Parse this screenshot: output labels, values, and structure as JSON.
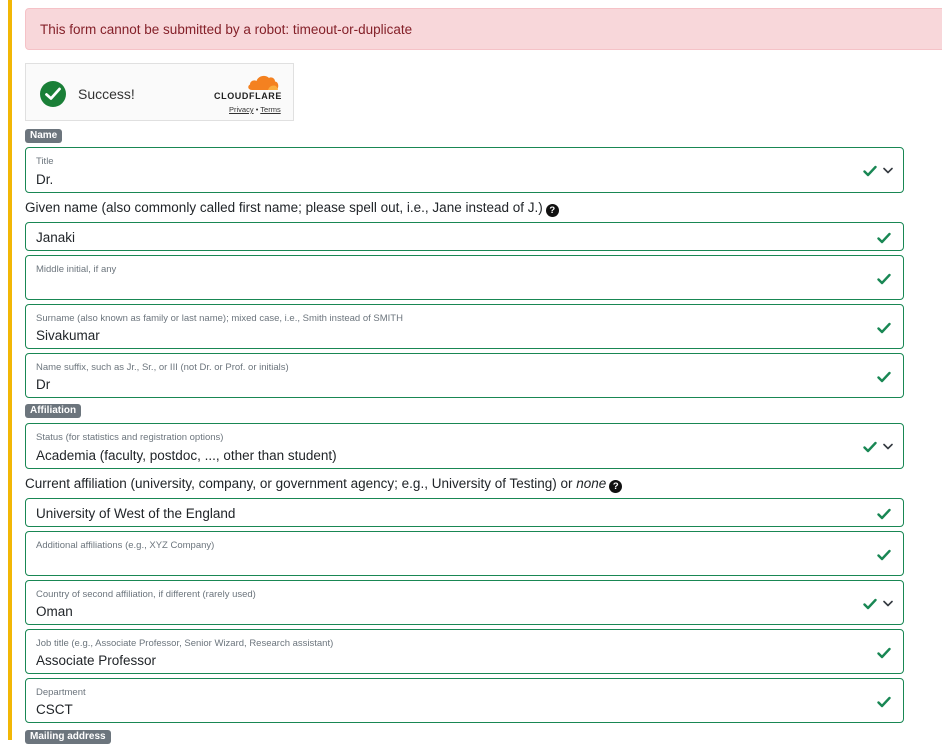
{
  "alert": {
    "text": "This form cannot be submitted by a robot: timeout-or-duplicate"
  },
  "captcha": {
    "status": "Success!",
    "brand": "CLOUDFLARE",
    "privacy": "Privacy",
    "separator": "•",
    "terms": "Terms"
  },
  "sections": {
    "name": "Name",
    "affiliation": "Affiliation",
    "mailing": "Mailing address"
  },
  "fields": {
    "title": {
      "label": "Title",
      "value": "Dr."
    },
    "given_name": {
      "label": "Given name (also commonly called first name; please spell out, i.e., Jane instead of J.)",
      "value": "Janaki"
    },
    "middle_initial": {
      "label": "Middle initial, if any",
      "value": ""
    },
    "surname": {
      "label": "Surname (also known as family or last name); mixed case, i.e., Smith instead of SMITH",
      "value": "Sivakumar"
    },
    "suffix": {
      "label": "Name suffix, such as Jr., Sr., or III (not Dr. or Prof. or initials)",
      "value": "Dr"
    },
    "status": {
      "label": "Status (for statistics and registration options)",
      "value": "Academia (faculty, postdoc, ..., other than student)"
    },
    "affiliation": {
      "label": "Current affiliation (university, company, or government agency; e.g., University of Testing) or",
      "label_em": "none",
      "value": "University of West of the England"
    },
    "additional_affiliations": {
      "label": "Additional affiliations (e.g., XYZ Company)",
      "value": ""
    },
    "second_country": {
      "label": "Country of second affiliation, if different (rarely used)",
      "value": "Oman"
    },
    "job_title": {
      "label": "Job title (e.g., Associate Professor, Senior Wizard, Research assistant)",
      "value": "Associate Professor"
    },
    "department": {
      "label": "Department",
      "value": "CSCT"
    }
  },
  "colors": {
    "valid": "#198754",
    "alert_bg": "#f8d7da",
    "badge": "#6c757d"
  }
}
